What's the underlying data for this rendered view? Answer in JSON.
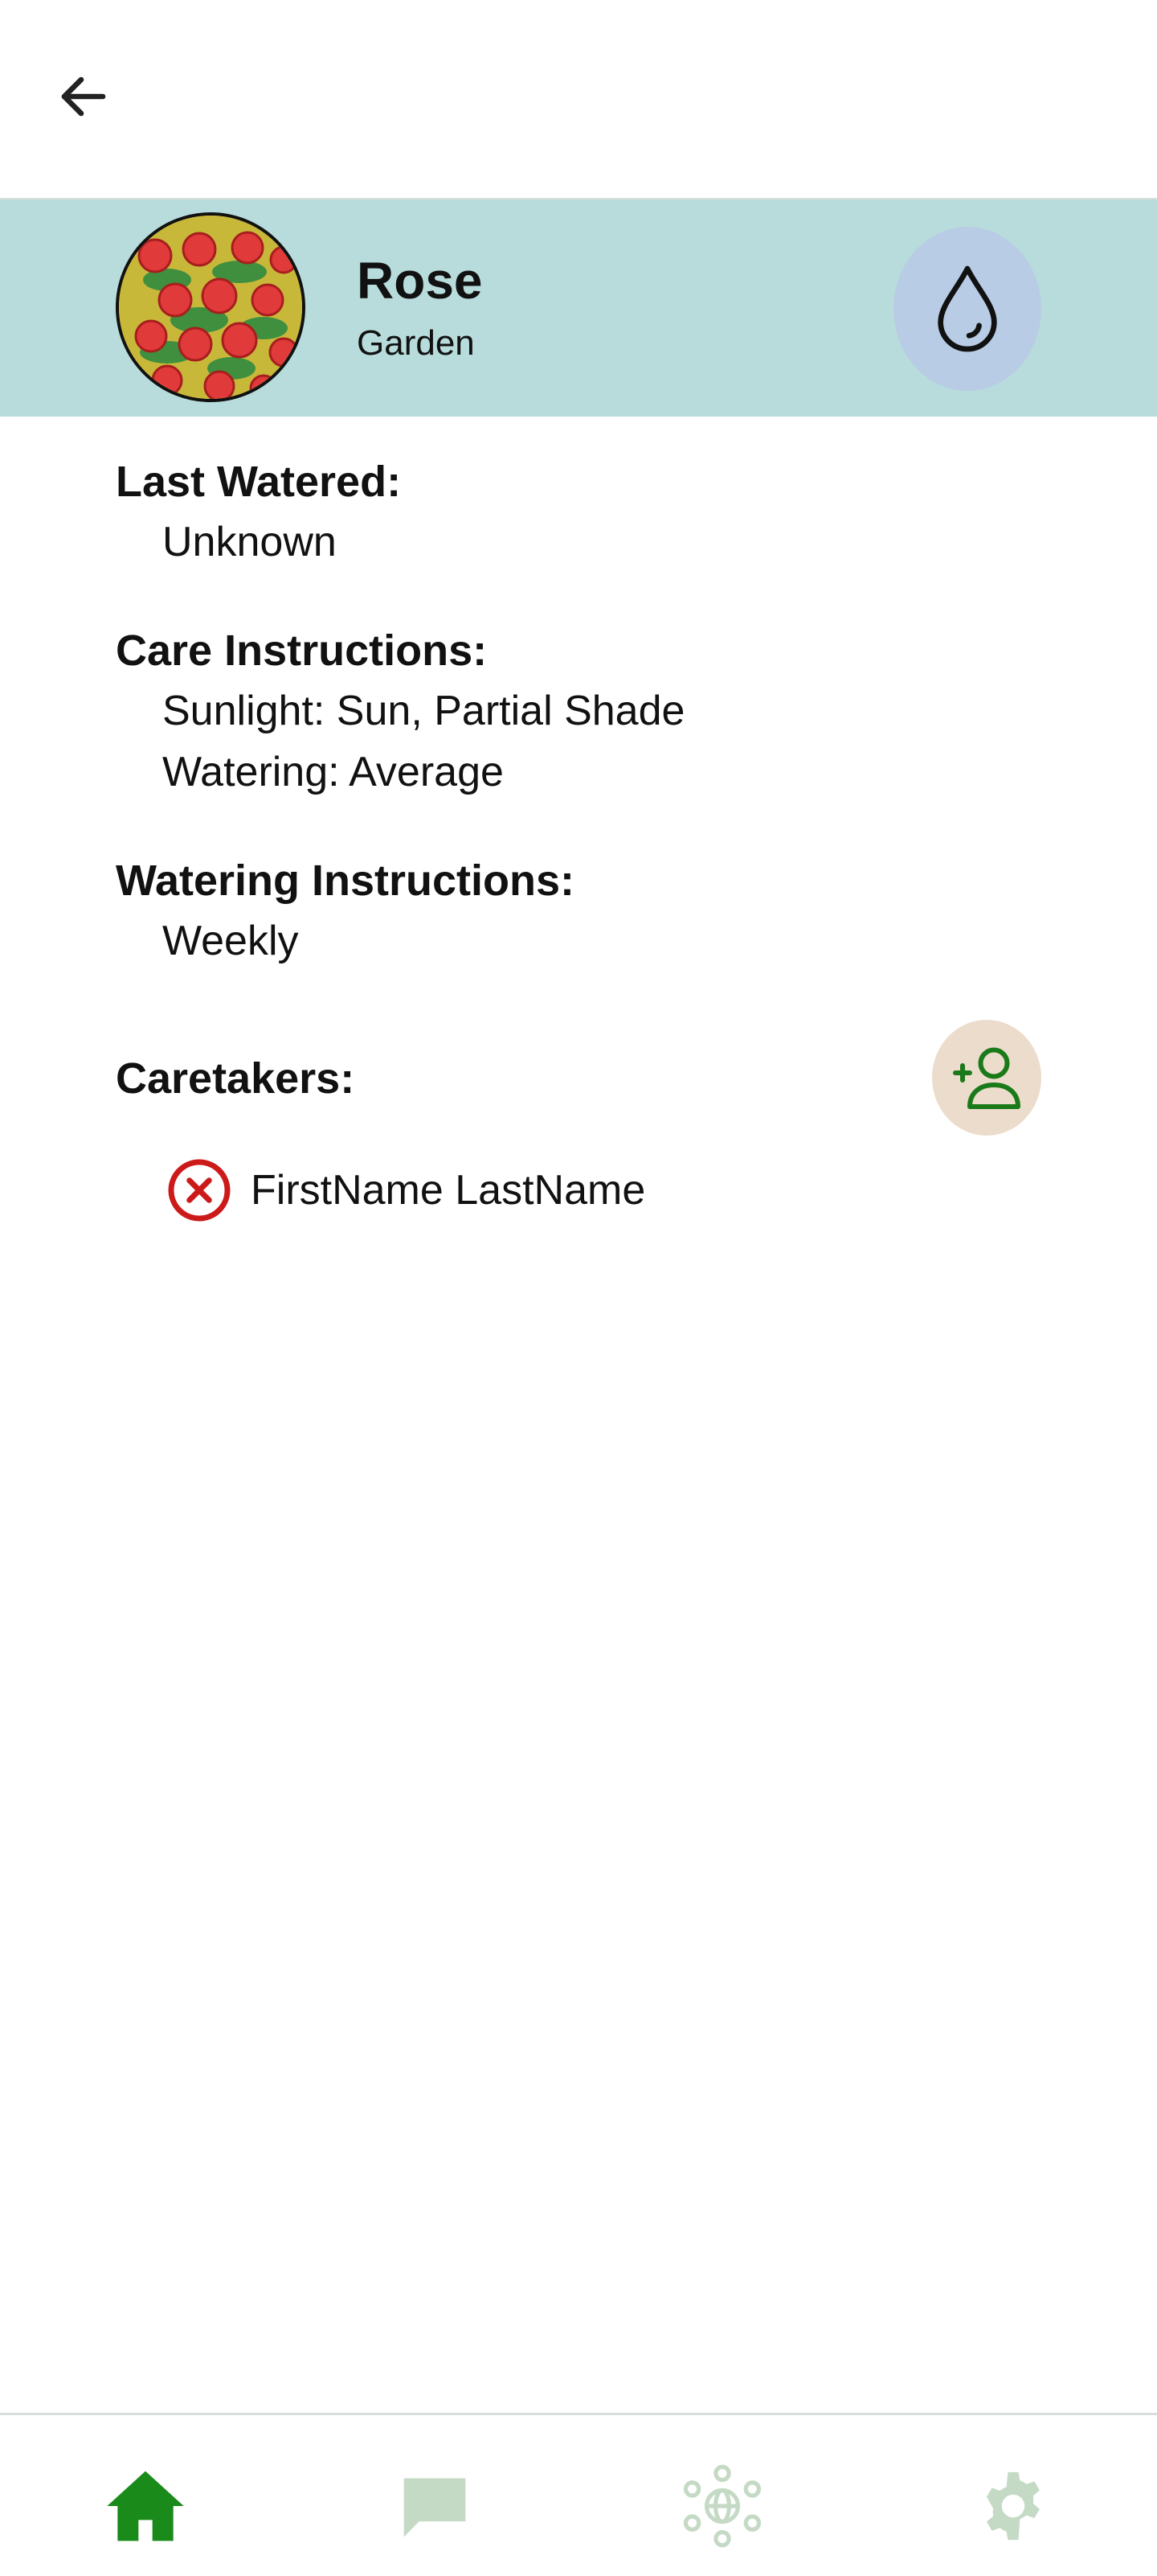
{
  "plant": {
    "name": "Rose",
    "location": "Garden"
  },
  "details": {
    "last_watered_label": "Last Watered:",
    "last_watered_value": "Unknown",
    "care_label": "Care Instructions:",
    "sunlight": "Sunlight: Sun, Partial Shade",
    "watering": "Watering: Average",
    "watering_instructions_label": "Watering Instructions:",
    "watering_instructions_value": "Weekly",
    "caretakers_label": "Caretakers:"
  },
  "caretakers": [
    {
      "name": "FirstName LastName"
    }
  ],
  "icons": {
    "back": "arrow-left-icon",
    "water": "water-drop-icon",
    "add_caretaker": "add-person-icon",
    "remove": "close-circle-icon",
    "nav": [
      "home-icon",
      "chat-icon",
      "community-icon",
      "settings-icon"
    ]
  },
  "colors": {
    "header_band": "#b8dcdc",
    "water_button": "#b8cce5",
    "add_button": "#ecdccb",
    "nav_active": "#1a8a1a",
    "nav_inactive": "#c5dac5",
    "remove_red": "#cc1a1a"
  }
}
